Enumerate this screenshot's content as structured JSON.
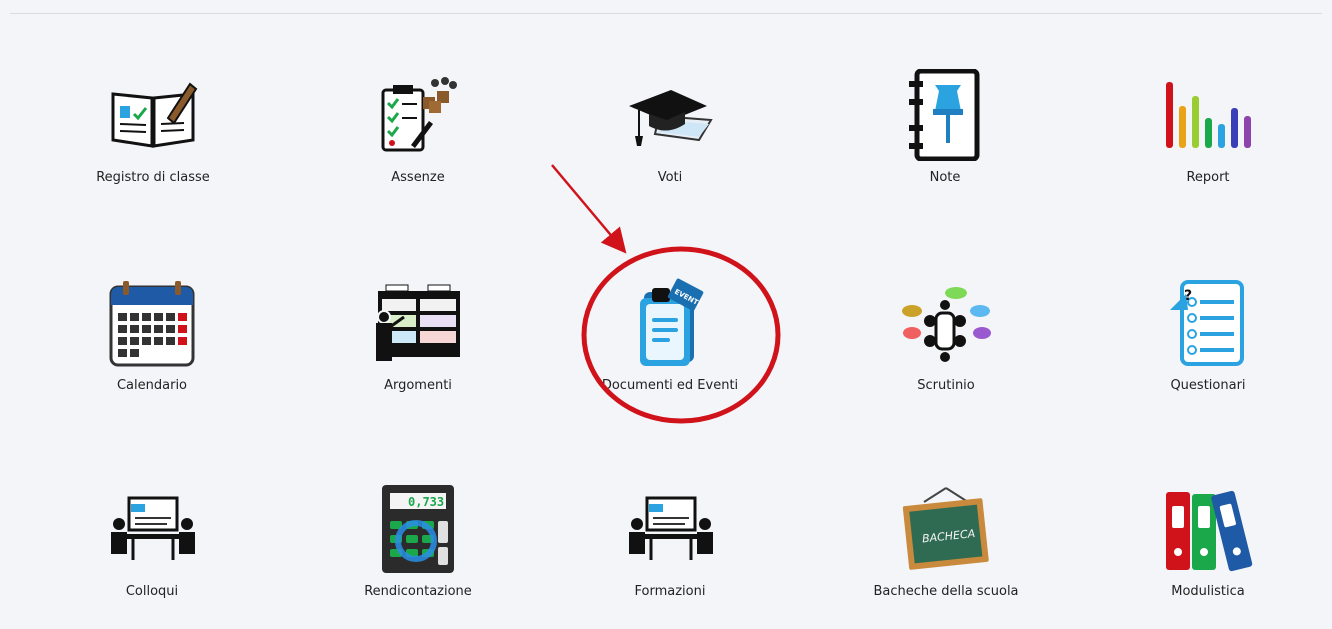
{
  "tiles": [
    {
      "label": "Registro di classe"
    },
    {
      "label": "Assenze"
    },
    {
      "label": "Voti"
    },
    {
      "label": "Note"
    },
    {
      "label": "Report"
    },
    {
      "label": "Calendario"
    },
    {
      "label": "Argomenti"
    },
    {
      "label": "Documenti ed Eventi",
      "badge": "EVENTI"
    },
    {
      "label": "Scrutinio"
    },
    {
      "label": "Questionari"
    },
    {
      "label": "Colloqui"
    },
    {
      "label": "Rendicontazione",
      "display": "0,733"
    },
    {
      "label": "Formazioni"
    },
    {
      "label": "Bacheche della scuola",
      "board_text": "BACHECA"
    },
    {
      "label": "Modulistica"
    }
  ],
  "annotation": {
    "color": "#d0131a",
    "highlighted_tile": "Documenti ed Eventi"
  },
  "colors": {
    "background": "#f4f5f9",
    "calendar_blue": "#1f5aa6",
    "document_blue": "#2aa3e0",
    "calculator_green": "#1aa84a",
    "board_green": "#2f6b52"
  }
}
